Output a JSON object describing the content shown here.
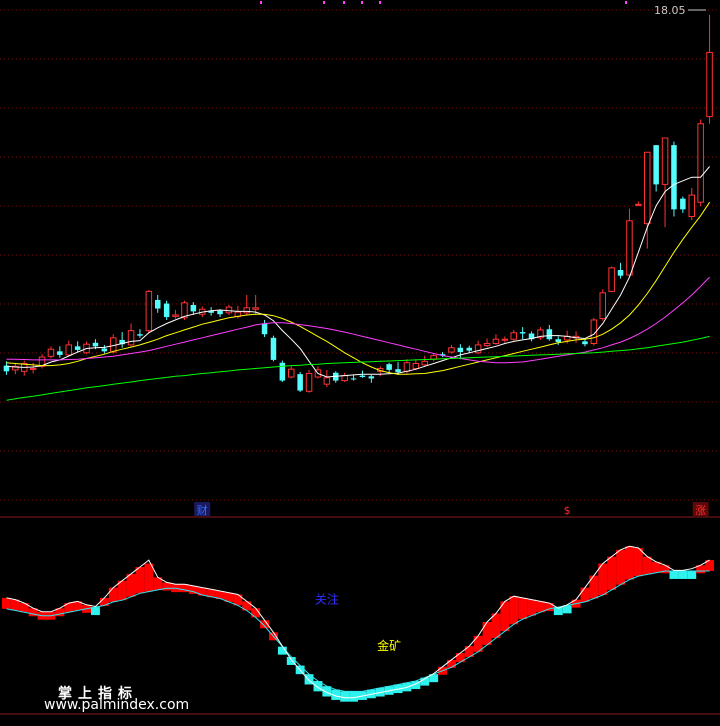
{
  "chart_data": [
    {
      "type": "candlestick",
      "panel": "price",
      "price_readout": "18.05",
      "ylim": [
        7.2,
        18.3
      ],
      "up_color": "#ff3232",
      "down_color": "#54fcfc",
      "candles": [
        [
          8.22,
          8.06,
          8.34,
          7.96
        ],
        [
          8.1,
          8.2,
          8.3,
          7.98
        ],
        [
          8.06,
          8.28,
          8.36,
          7.94
        ],
        [
          8.12,
          8.14,
          8.3,
          8.0
        ],
        [
          8.2,
          8.46,
          8.54,
          8.14
        ],
        [
          8.48,
          8.68,
          8.76,
          8.42
        ],
        [
          8.62,
          8.52,
          8.76,
          8.44
        ],
        [
          8.52,
          8.8,
          8.92,
          8.48
        ],
        [
          8.76,
          8.66,
          8.9,
          8.6
        ],
        [
          8.58,
          8.82,
          8.9,
          8.54
        ],
        [
          8.86,
          8.76,
          8.96,
          8.68
        ],
        [
          8.7,
          8.62,
          8.8,
          8.56
        ],
        [
          8.6,
          9.0,
          9.1,
          8.56
        ],
        [
          8.94,
          8.82,
          9.16,
          8.72
        ],
        [
          8.8,
          9.2,
          9.4,
          8.76
        ],
        [
          9.1,
          9.06,
          9.24,
          9.0
        ],
        [
          9.2,
          10.3,
          10.34,
          9.14
        ],
        [
          10.06,
          9.82,
          10.2,
          9.7
        ],
        [
          9.96,
          9.58,
          10.04,
          9.5
        ],
        [
          9.6,
          9.64,
          9.78,
          9.54
        ],
        [
          9.56,
          9.98,
          10.04,
          9.5
        ],
        [
          9.92,
          9.74,
          10.0,
          9.64
        ],
        [
          9.66,
          9.8,
          9.88,
          9.58
        ],
        [
          9.76,
          9.7,
          9.86,
          9.62
        ],
        [
          9.76,
          9.66,
          9.8,
          9.58
        ],
        [
          9.7,
          9.86,
          9.92,
          9.64
        ],
        [
          9.6,
          9.72,
          9.9,
          9.54
        ],
        [
          9.7,
          9.84,
          10.2,
          9.64
        ],
        [
          9.8,
          9.84,
          10.2,
          9.64
        ],
        [
          9.4,
          9.1,
          9.5,
          9.02
        ],
        [
          9.0,
          8.38,
          9.06,
          8.34
        ],
        [
          8.3,
          7.8,
          8.36,
          7.76
        ],
        [
          7.9,
          8.12,
          8.2,
          7.86
        ],
        [
          7.98,
          7.52,
          8.04,
          7.48
        ],
        [
          7.5,
          8.0,
          8.1,
          7.46
        ],
        [
          7.9,
          8.1,
          8.2,
          7.86
        ],
        [
          7.7,
          7.88,
          8.1,
          7.62
        ],
        [
          8.02,
          7.8,
          8.06,
          7.74
        ],
        [
          7.8,
          7.94,
          8.02,
          7.76
        ],
        [
          7.86,
          7.84,
          7.96,
          7.8
        ],
        [
          7.94,
          7.9,
          8.08,
          7.88
        ],
        [
          7.92,
          7.86,
          7.96,
          7.74
        ],
        [
          8.06,
          8.14,
          8.2,
          7.92
        ],
        [
          8.26,
          8.1,
          8.3,
          8.0
        ],
        [
          8.12,
          8.04,
          8.32,
          7.96
        ],
        [
          8.06,
          8.3,
          8.4,
          8.0
        ],
        [
          8.14,
          8.28,
          8.4,
          8.1
        ],
        [
          8.24,
          8.34,
          8.5,
          8.2
        ],
        [
          8.4,
          8.5,
          8.56,
          8.34
        ],
        [
          8.54,
          8.5,
          8.6,
          8.46
        ],
        [
          8.6,
          8.72,
          8.8,
          8.56
        ],
        [
          8.72,
          8.6,
          8.82,
          8.4
        ],
        [
          8.72,
          8.64,
          8.78,
          8.56
        ],
        [
          8.58,
          8.8,
          8.92,
          8.54
        ],
        [
          8.78,
          8.84,
          8.98,
          8.74
        ],
        [
          8.84,
          8.96,
          9.1,
          8.8
        ],
        [
          8.94,
          8.96,
          9.04,
          8.86
        ],
        [
          8.96,
          9.14,
          9.22,
          8.92
        ],
        [
          9.16,
          9.12,
          9.3,
          8.96
        ],
        [
          9.12,
          8.96,
          9.18,
          8.9
        ],
        [
          9.0,
          9.22,
          9.3,
          8.94
        ],
        [
          9.24,
          8.96,
          9.36,
          8.92
        ],
        [
          8.96,
          8.88,
          9.04,
          8.8
        ],
        [
          8.94,
          9.04,
          9.2,
          8.84
        ],
        [
          9.0,
          9.04,
          9.18,
          8.86
        ],
        [
          8.9,
          8.82,
          8.96,
          8.76
        ],
        [
          8.84,
          9.5,
          9.56,
          8.78
        ],
        [
          9.54,
          10.26,
          10.36,
          9.48
        ],
        [
          10.3,
          10.96,
          11.0,
          10.28
        ],
        [
          10.9,
          10.74,
          11.1,
          10.66
        ],
        [
          10.76,
          12.28,
          12.62,
          10.7
        ],
        [
          12.74,
          12.74,
          12.82,
          12.7
        ],
        [
          12.2,
          14.2,
          14.2,
          11.5
        ],
        [
          14.4,
          13.3,
          14.4,
          13.1
        ],
        [
          13.3,
          14.6,
          14.6,
          12.1
        ],
        [
          14.4,
          12.6,
          14.5,
          12.4
        ],
        [
          12.9,
          12.6,
          12.96,
          12.5
        ],
        [
          12.4,
          13.0,
          13.2,
          12.3
        ],
        [
          12.8,
          15.0,
          15.12,
          12.7
        ],
        [
          15.2,
          17.0,
          18.05,
          15.0
        ]
      ],
      "moving_averages": [
        {
          "name": "MA5",
          "color": "#ffffff",
          "values": [
            8.2,
            8.18,
            8.17,
            8.18,
            8.22,
            8.32,
            8.38,
            8.49,
            8.6,
            8.7,
            8.72,
            8.73,
            8.78,
            8.84,
            8.9,
            8.92,
            9.14,
            9.28,
            9.4,
            9.5,
            9.6,
            9.66,
            9.72,
            9.76,
            9.78,
            9.76,
            9.74,
            9.74,
            9.72,
            9.64,
            9.48,
            9.2,
            8.96,
            8.7,
            8.34,
            8.0,
            7.9,
            7.92,
            7.94,
            7.96,
            7.98,
            7.98,
            7.98,
            7.99,
            8.01,
            8.06,
            8.12,
            8.2,
            8.28,
            8.36,
            8.44,
            8.52,
            8.58,
            8.64,
            8.7,
            8.76,
            8.84,
            8.9,
            8.94,
            8.98,
            9.04,
            9.06,
            9.06,
            9.04,
            9.0,
            8.98,
            9.1,
            9.4,
            9.8,
            10.2,
            10.7,
            11.4,
            12.1,
            12.7,
            13.1,
            13.3,
            13.4,
            13.5,
            13.5,
            13.8
          ]
        },
        {
          "name": "MA10",
          "color": "#ffff00",
          "values": [
            8.3,
            8.28,
            8.26,
            8.24,
            8.22,
            8.22,
            8.24,
            8.28,
            8.34,
            8.42,
            8.48,
            8.54,
            8.62,
            8.68,
            8.74,
            8.8,
            8.88,
            8.96,
            9.06,
            9.14,
            9.22,
            9.3,
            9.38,
            9.44,
            9.5,
            9.56,
            9.6,
            9.64,
            9.66,
            9.66,
            9.62,
            9.54,
            9.44,
            9.32,
            9.18,
            9.04,
            8.9,
            8.74,
            8.58,
            8.44,
            8.3,
            8.18,
            8.08,
            8.02,
            7.98,
            7.98,
            7.99,
            8.0,
            8.04,
            8.08,
            8.14,
            8.2,
            8.26,
            8.32,
            8.38,
            8.44,
            8.5,
            8.56,
            8.62,
            8.68,
            8.74,
            8.8,
            8.86,
            8.9,
            8.94,
            8.96,
            9.0,
            9.1,
            9.24,
            9.42,
            9.64,
            9.92,
            10.24,
            10.6,
            11.0,
            11.4,
            11.76,
            12.1,
            12.42,
            12.8
          ]
        },
        {
          "name": "MA20",
          "color": "#ff3fff",
          "values": [
            8.4,
            8.4,
            8.39,
            8.38,
            8.38,
            8.38,
            8.38,
            8.39,
            8.4,
            8.42,
            8.44,
            8.46,
            8.48,
            8.52,
            8.56,
            8.6,
            8.64,
            8.7,
            8.76,
            8.82,
            8.88,
            8.94,
            9.0,
            9.06,
            9.12,
            9.18,
            9.24,
            9.3,
            9.36,
            9.4,
            9.42,
            9.42,
            9.4,
            9.37,
            9.34,
            9.3,
            9.26,
            9.21,
            9.16,
            9.1,
            9.04,
            8.98,
            8.92,
            8.86,
            8.8,
            8.74,
            8.68,
            8.62,
            8.56,
            8.5,
            8.46,
            8.42,
            8.38,
            8.34,
            8.32,
            8.3,
            8.3,
            8.31,
            8.32,
            8.36,
            8.4,
            8.44,
            8.48,
            8.52,
            8.56,
            8.6,
            8.66,
            8.72,
            8.8,
            8.88,
            8.98,
            9.1,
            9.24,
            9.4,
            9.58,
            9.78,
            9.98,
            10.2,
            10.44,
            10.7
          ]
        },
        {
          "name": "MA60",
          "color": "#00ff00",
          "values": [
            7.25,
            7.29,
            7.33,
            7.36,
            7.4,
            7.44,
            7.48,
            7.52,
            7.56,
            7.6,
            7.63,
            7.66,
            7.7,
            7.73,
            7.76,
            7.8,
            7.83,
            7.86,
            7.89,
            7.92,
            7.94,
            7.97,
            8.0,
            8.02,
            8.05,
            8.07,
            8.1,
            8.12,
            8.14,
            8.16,
            8.18,
            8.2,
            8.22,
            8.23,
            8.25,
            8.26,
            8.28,
            8.29,
            8.3,
            8.31,
            8.32,
            8.33,
            8.34,
            8.35,
            8.36,
            8.37,
            8.38,
            8.39,
            8.4,
            8.41,
            8.42,
            8.43,
            8.44,
            8.45,
            8.46,
            8.47,
            8.48,
            8.49,
            8.5,
            8.51,
            8.52,
            8.53,
            8.54,
            8.55,
            8.56,
            8.57,
            8.58,
            8.6,
            8.62,
            8.64,
            8.66,
            8.69,
            8.72,
            8.76,
            8.8,
            8.84,
            8.88,
            8.93,
            8.98,
            9.04
          ]
        }
      ],
      "markers": [
        {
          "label": "财",
          "index": 22,
          "color": "#2f6bff",
          "bg": "#1a1a60"
        },
        {
          "label": "$",
          "index": 63,
          "color": "#ff2a2a",
          "bg": "#000000"
        },
        {
          "label": "涨",
          "index": 78,
          "color": "#ff2a2a",
          "bg": "#5a0a0a"
        }
      ],
      "top_dots_color": "#ff3fff"
    },
    {
      "type": "step_bar",
      "panel": "indicator",
      "ylim": [
        0,
        100
      ],
      "up_color": "#ff0000",
      "down_color": "#2ef2ee",
      "values": [
        64,
        63,
        61,
        58,
        56,
        56,
        58,
        61,
        62,
        60,
        59,
        64,
        70,
        74,
        78,
        82,
        84,
        76,
        73,
        72,
        72,
        71,
        70,
        69,
        68,
        67,
        66,
        62,
        58,
        51,
        44,
        36,
        28,
        22,
        16,
        12,
        9,
        7,
        6,
        6,
        7,
        8,
        9,
        10,
        11,
        12,
        14,
        17,
        20,
        24,
        28,
        32,
        36,
        42,
        50,
        55,
        62,
        65,
        64,
        63,
        62,
        61,
        58,
        60,
        63,
        70,
        77,
        84,
        88,
        92,
        94,
        93,
        88,
        85,
        83,
        80,
        80,
        81,
        83,
        86
      ],
      "signal": [
        60,
        59,
        58,
        57,
        56,
        56,
        57,
        58,
        59,
        60,
        61,
        62,
        64,
        65,
        67,
        69,
        70,
        71,
        72,
        72,
        71,
        70,
        68,
        67,
        66,
        64,
        62,
        59,
        55,
        50,
        44,
        38,
        32,
        27,
        22,
        18,
        15,
        13,
        12,
        12,
        12,
        13,
        14,
        15,
        16,
        17,
        18,
        20,
        22,
        24,
        26,
        29,
        32,
        35,
        39,
        43,
        47,
        51,
        54,
        56,
        58,
        60,
        61,
        62,
        63,
        64,
        66,
        68,
        71,
        74,
        77,
        79,
        80,
        81,
        82,
        82,
        82,
        82,
        82,
        82
      ],
      "white_line": [
        64,
        63,
        61,
        58,
        56,
        56,
        58,
        61,
        62,
        60,
        59,
        64,
        70,
        74,
        78,
        82,
        86,
        76,
        73,
        72,
        72,
        71,
        70,
        69,
        68,
        67,
        66,
        62,
        58,
        51,
        44,
        36,
        28,
        22,
        16,
        12,
        9,
        7,
        6,
        6,
        7,
        8,
        9,
        10,
        11,
        12,
        14,
        17,
        20,
        24,
        28,
        32,
        36,
        42,
        50,
        55,
        62,
        65,
        64,
        63,
        62,
        61,
        58,
        60,
        63,
        70,
        77,
        84,
        88,
        92,
        94,
        93,
        88,
        85,
        83,
        80,
        80,
        81,
        83,
        86
      ],
      "annotations": [
        {
          "label": "关注",
          "index": 36,
          "value": 63,
          "color": "#2f2fff"
        },
        {
          "label": "金矿",
          "index": 43,
          "value": 36,
          "color": "#ffff00"
        }
      ]
    }
  ],
  "branding": {
    "title": "掌上指标",
    "site": "www.palmindex.com"
  }
}
